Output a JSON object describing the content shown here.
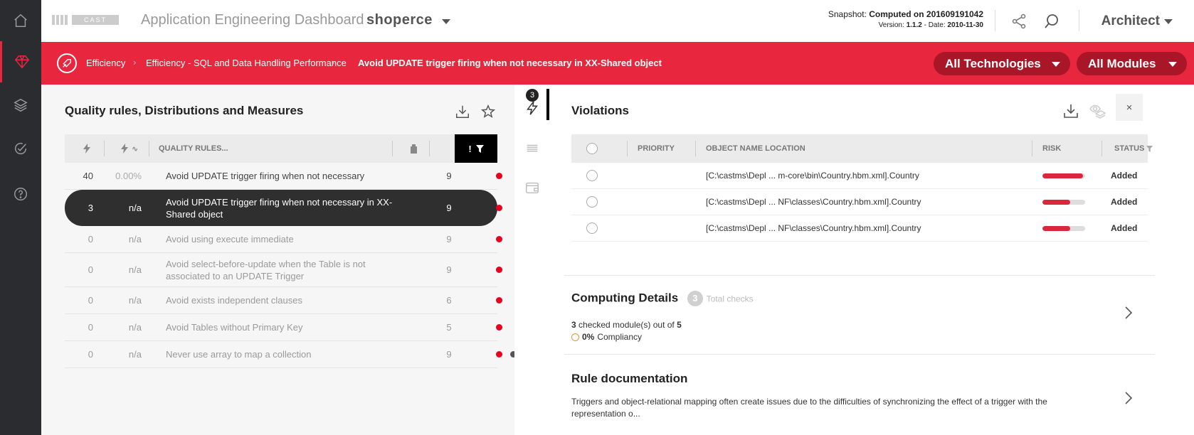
{
  "header": {
    "logo_text": "CAST",
    "app_title": "Application Engineering Dashboard -",
    "app_name": "shoperce",
    "snapshot_label": "Snapshot:",
    "snapshot_value": "Computed on 201609191042",
    "version_label": "Version:",
    "version_value": "1.1.2",
    "date_label": "- Date:",
    "date_value": "2010-11-30",
    "role": "Architect"
  },
  "nav": {
    "items": [
      "home-icon",
      "diamond-icon",
      "layers-icon",
      "check-circle-icon",
      "help-icon"
    ]
  },
  "breadcrumb": {
    "items": [
      "Efficiency",
      "Efficiency - SQL and Data Handling Performance",
      "Avoid UPDATE trigger firing when not necessary in XX-Shared object"
    ],
    "filters": [
      "All Technologies",
      "All Modules"
    ]
  },
  "quality": {
    "title": "Quality rules, Distributions and Measures",
    "headers": {
      "rules": "QUALITY RULES...",
      "critical": "!"
    },
    "rows": [
      {
        "violations": "40",
        "variation": "0.00%",
        "rule": "Avoid UPDATE trigger firing when not necessary",
        "weight": "9"
      },
      {
        "violations": "3",
        "variation": "n/a",
        "rule": "Avoid UPDATE trigger firing when not necessary in XX-Shared object",
        "weight": "9"
      },
      {
        "violations": "0",
        "variation": "n/a",
        "rule": "Avoid using execute immediate",
        "weight": "9"
      },
      {
        "violations": "0",
        "variation": "n/a",
        "rule": "Avoid select-before-update when the Table is not associated to an UPDATE Trigger",
        "weight": "9"
      },
      {
        "violations": "0",
        "variation": "n/a",
        "rule": "Avoid exists independent clauses",
        "weight": "6"
      },
      {
        "violations": "0",
        "variation": "n/a",
        "rule": "Avoid Tables without Primary Key",
        "weight": "5"
      },
      {
        "violations": "0",
        "variation": "n/a",
        "rule": "Never use array to map a collection",
        "weight": "9"
      }
    ]
  },
  "midcol": {
    "badge": "3"
  },
  "violations": {
    "title": "Violations",
    "headers": {
      "priority": "PRIORITY",
      "object": "OBJECT NAME LOCATION",
      "risk": "RISK",
      "status": "STATUS"
    },
    "close_label": "×",
    "rows": [
      {
        "object": "[C:\\castms\\Depl ... m-core\\bin\\Country.hbm.xml].Country",
        "risk": 0.95,
        "status": "Added"
      },
      {
        "object": "[C:\\castms\\Depl ... NF\\classes\\Country.hbm.xml].Country",
        "risk": 0.65,
        "status": "Added"
      },
      {
        "object": "[C:\\castms\\Depl ... NF\\classes\\Country.hbm.xml].Country",
        "risk": 0.65,
        "status": "Added"
      }
    ]
  },
  "computing": {
    "title": "Computing Details",
    "count": "3",
    "count_label": "Total checks",
    "checked": "3",
    "checked_text": "checked module(s) out of",
    "total": "5",
    "compliance": "0%",
    "compliance_label": "Compliancy"
  },
  "documentation": {
    "title": "Rule documentation",
    "text_line1": "Triggers and object-relational mapping often create issues due to the difficulties of synchronizing the effect of a trigger with the",
    "text_line2": "representation o..."
  },
  "colors": {
    "accent": "#e8273e",
    "nav_bg": "#2a2c2f",
    "dark_pill": "#a81628"
  }
}
